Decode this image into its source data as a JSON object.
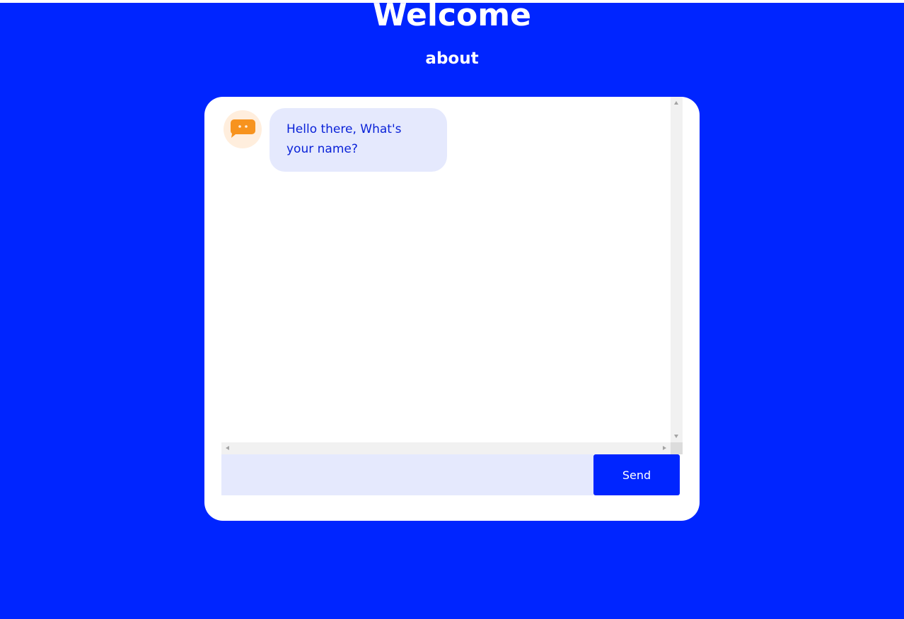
{
  "header": {
    "title": "Welcome",
    "about_link": "about"
  },
  "chat": {
    "bot_avatar_icon": "chat-bubble-icon",
    "messages": [
      {
        "sender": "bot",
        "text": "Hello there, What's your name?"
      }
    ],
    "input": {
      "value": "",
      "placeholder": ""
    },
    "send_label": "Send"
  },
  "colors": {
    "background": "#0025ff",
    "card": "#ffffff",
    "bubble": "#e5e9fd",
    "bubble_text": "#0a22d8",
    "avatar_bg": "#ffeedd",
    "icon": "#f7931e"
  }
}
